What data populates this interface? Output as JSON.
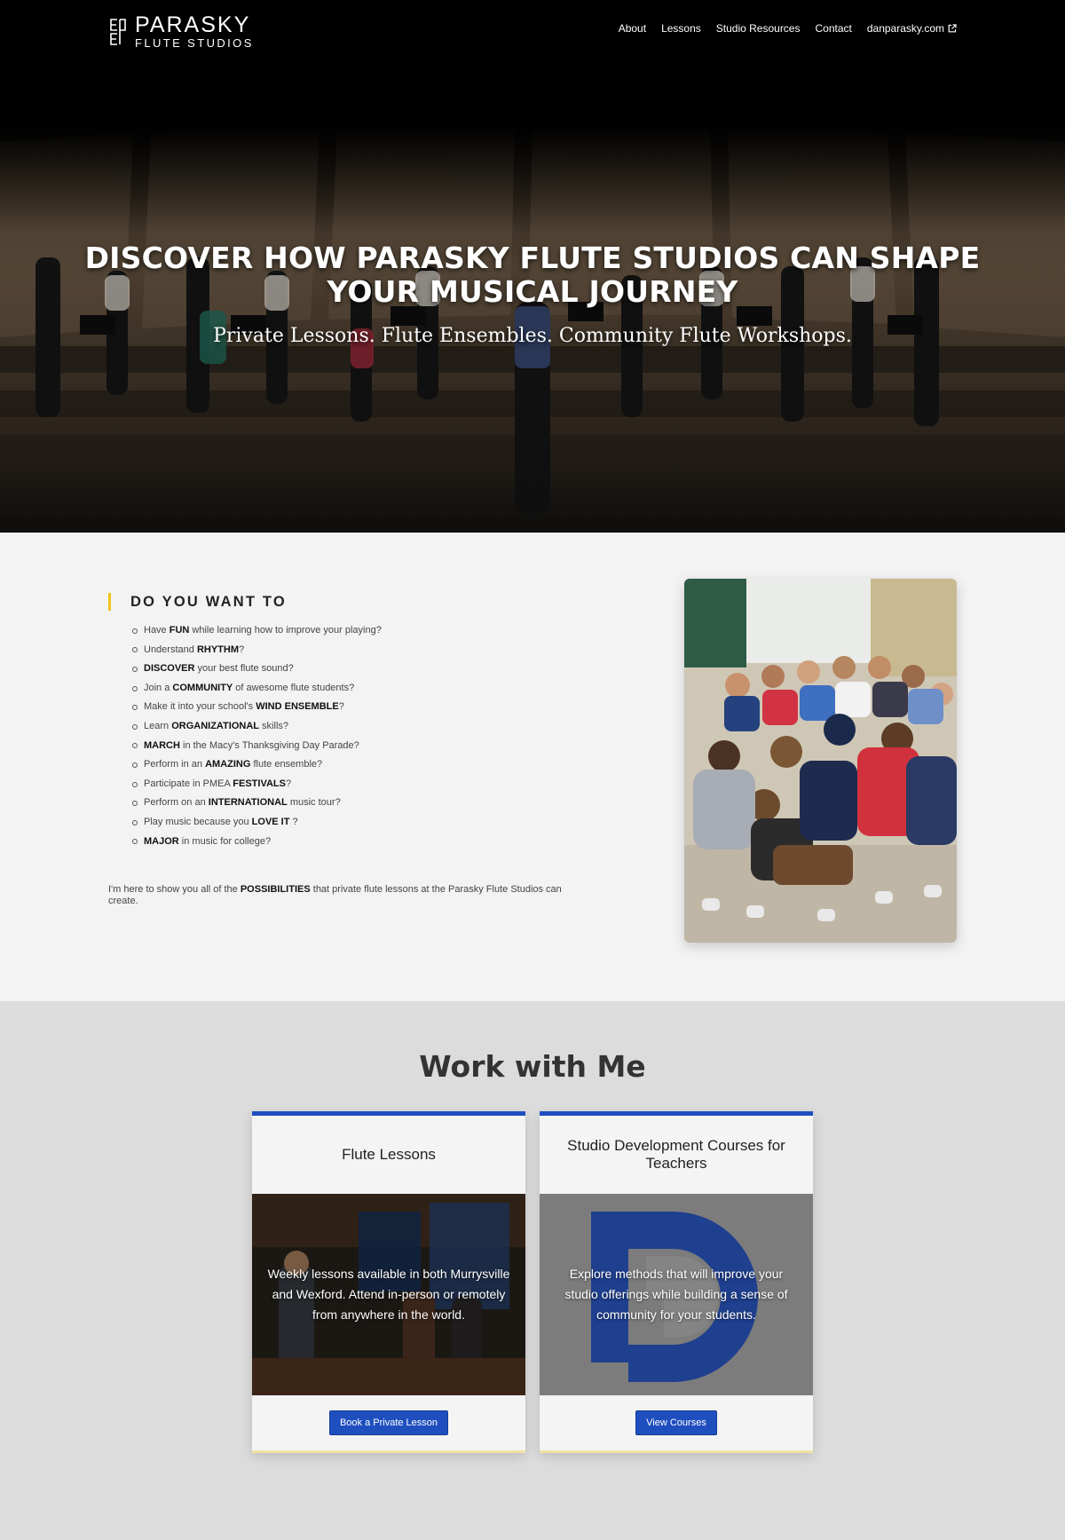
{
  "logo": {
    "line1": "PARASKY",
    "line2": "FLUTE STUDIOS"
  },
  "nav": {
    "items": [
      {
        "label": "About"
      },
      {
        "label": "Lessons"
      },
      {
        "label": "Studio Resources"
      },
      {
        "label": "Contact"
      },
      {
        "label": "danparasky.com",
        "external": true
      }
    ]
  },
  "hero": {
    "title_line1": "DISCOVER HOW PARASKY FLUTE STUDIOS CAN SHAPE",
    "title_line2": "YOUR MUSICAL JOURNEY",
    "subtitle": "Private Lessons. Flute Ensembles. Community Flute Workshops."
  },
  "intro": {
    "heading": "DO YOU WANT TO",
    "items": [
      {
        "pre": "Have ",
        "bold": "FUN",
        "post": " while learning how to improve your playing?"
      },
      {
        "pre": "Understand ",
        "bold": "RHYTHM",
        "post": "?"
      },
      {
        "pre": "",
        "bold": "DISCOVER",
        "post": " your best flute sound?"
      },
      {
        "pre": "Join a ",
        "bold": "COMMUNITY",
        "post": " of awesome flute students?"
      },
      {
        "pre": "Make it into your school's ",
        "bold": "WIND ENSEMBLE",
        "post": "?"
      },
      {
        "pre": "Learn ",
        "bold": "ORGANIZATIONAL",
        "post": " skills?"
      },
      {
        "pre": "",
        "bold": "MARCH",
        "post": " in the Macy's Thanksgiving Day Parade?"
      },
      {
        "pre": "Perform in an ",
        "bold": "AMAZING",
        "post": " flute ensemble?"
      },
      {
        "pre": "Participate in PMEA ",
        "bold": "FESTIVALS",
        "post": "?"
      },
      {
        "pre": "Perform on an ",
        "bold": "INTERNATIONAL",
        "post": " music tour?"
      },
      {
        "pre": "Play music because you ",
        "bold": "LOVE IT",
        "post": " ?"
      },
      {
        "pre": "",
        "bold": "MAJOR",
        "post": " in music for college?"
      }
    ],
    "closing_pre": "I'm here to show you all of the ",
    "closing_bold": "POSSIBILITIES",
    "closing_post": " that private flute lessons at the Parasky Flute Studios can create."
  },
  "work": {
    "title": "Work with Me",
    "cards": [
      {
        "title": "Flute Lessons",
        "text": "Weekly lessons available in both Murrysville and Wexford. Attend in-person or remotely from anywhere in the world.",
        "button": "Book a Private Lesson"
      },
      {
        "title": "Studio Development Courses for Teachers",
        "text": "Explore methods that will improve your studio offerings while building a sense of community for your students.",
        "button": "View Courses"
      }
    ]
  },
  "colors": {
    "accent_blue": "#1f4fbf",
    "heading_bar_yellow": "#f0c419",
    "intro_bg": "#f3f3f3",
    "work_bg": "#dcdcdc"
  }
}
